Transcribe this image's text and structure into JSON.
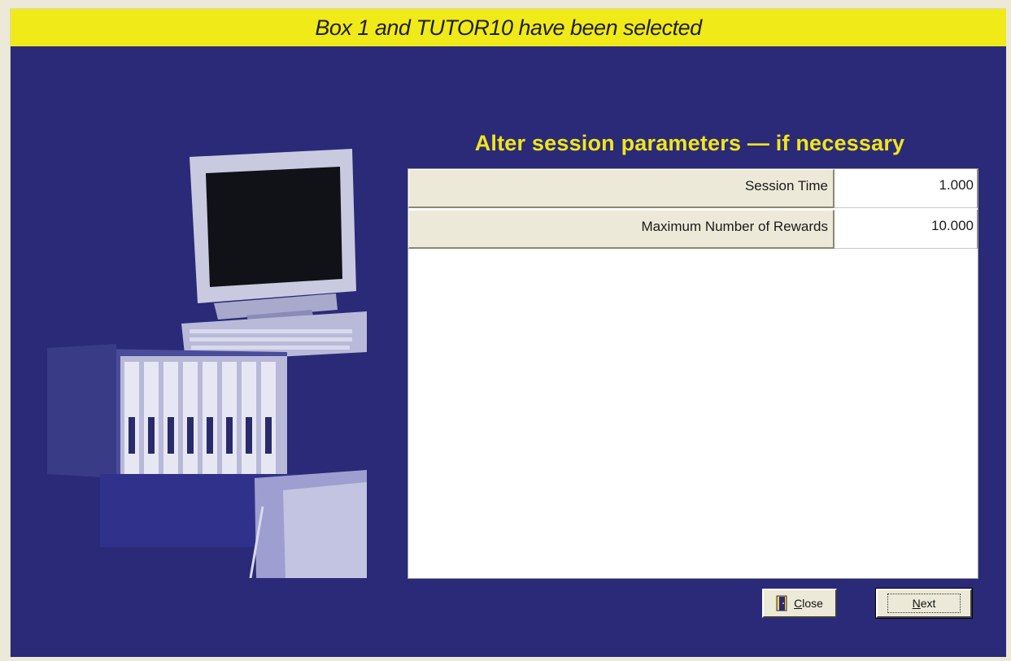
{
  "banner": {
    "title": "Box 1 and TUTOR10 have been selected"
  },
  "main": {
    "heading": "Alter session parameters — if necessary"
  },
  "parameters": [
    {
      "label": "Session Time",
      "value": "1.000"
    },
    {
      "label": "Maximum Number of Rewards",
      "value": "10.000"
    }
  ],
  "buttons": {
    "close": {
      "mnemonic": "C",
      "rest": "lose",
      "icon": "door-icon"
    },
    "next": {
      "mnemonic": "N",
      "rest": "ext"
    }
  },
  "colors": {
    "background": "#2a2a78",
    "banner": "#f1ea19",
    "heading": "#f1e51b"
  }
}
